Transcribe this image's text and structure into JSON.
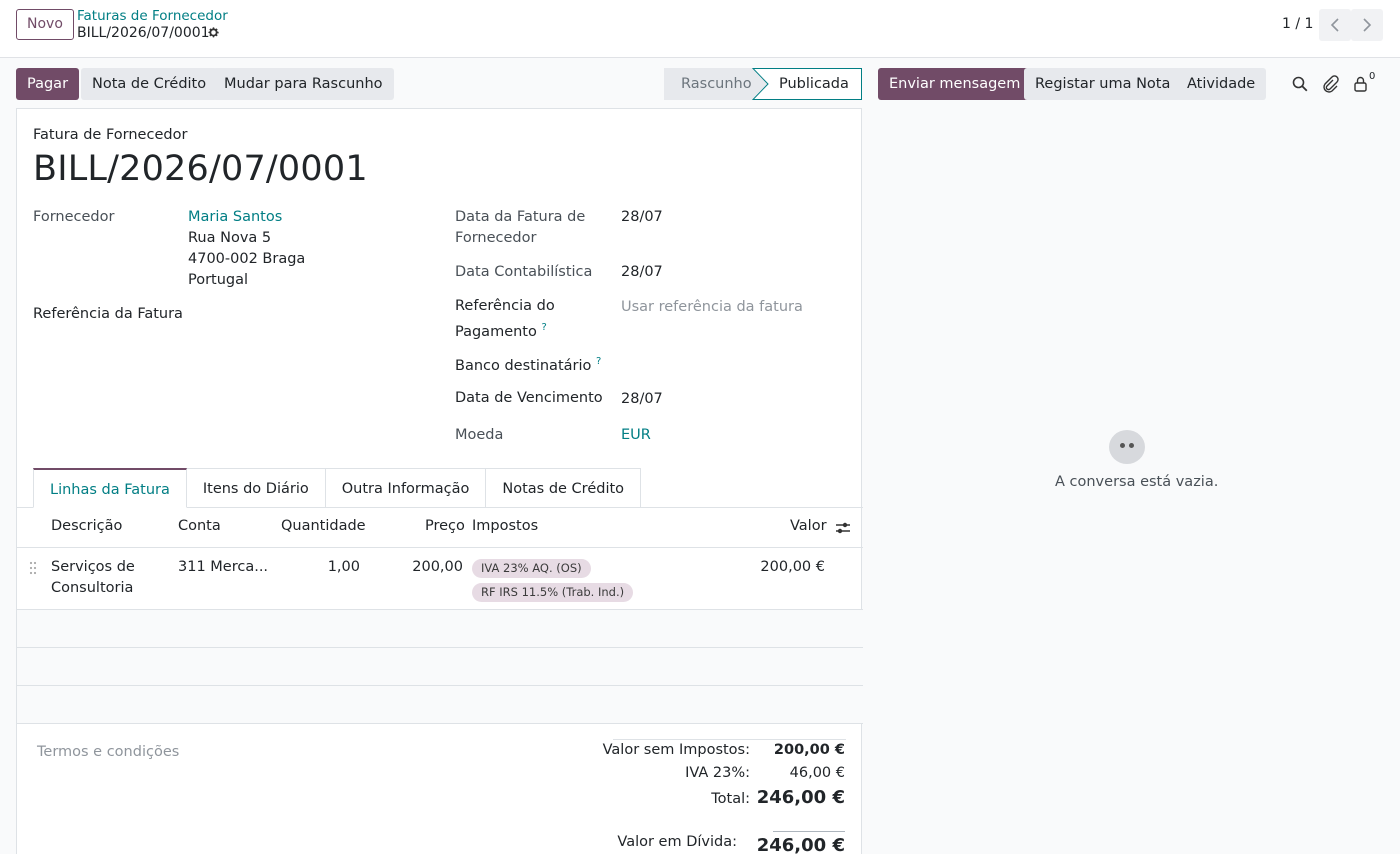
{
  "topbar": {
    "new_label": "Novo",
    "breadcrumb_parent": "Faturas de Fornecedor",
    "breadcrumb_current": "BILL/2026/07/0001",
    "pager": "1 / 1"
  },
  "actions": {
    "pay": "Pagar",
    "credit_note": "Nota de Crédito",
    "reset_draft": "Mudar para Rascunho"
  },
  "status": {
    "draft": "Rascunho",
    "posted": "Publicada"
  },
  "chatter": {
    "send_message": "Enviar mensagem",
    "log_note": "Registar uma Nota",
    "activity": "Atividade",
    "follower_count": "0",
    "empty_text": "A conversa está vazia."
  },
  "form": {
    "type": "Fatura de Fornecedor",
    "name": "BILL/2026/07/0001",
    "vendor_label": "Fornecedor",
    "vendor_name": "Maria Santos",
    "vendor_street": "Rua Nova 5",
    "vendor_city": "4700-002 Braga",
    "vendor_country": "Portugal",
    "bill_ref_label": "Referência da Fatura",
    "bill_date_label": "Data da Fatura de Fornecedor",
    "bill_date": "28/07",
    "accounting_date_label": "Data Contabilística",
    "accounting_date": "28/07",
    "payment_ref_label": "Referência do Pagamento",
    "payment_ref_placeholder": "Usar referência da fatura",
    "recipient_bank_label": "Banco destinatário",
    "due_date_label": "Data de Vencimento",
    "due_date": "28/07",
    "currency_label": "Moeda",
    "currency": "EUR"
  },
  "tabs": [
    "Linhas da Fatura",
    "Itens do Diário",
    "Outra Informação",
    "Notas de Crédito"
  ],
  "lines": {
    "headers": {
      "description": "Descrição",
      "account": "Conta",
      "quantity": "Quantidade",
      "price": "Preço",
      "taxes": "Impostos",
      "amount": "Valor"
    },
    "rows": [
      {
        "description": "Serviços de Consultoria",
        "account": "311 Merca...",
        "quantity": "1,00",
        "price": "200,00",
        "taxes": [
          "IVA 23% AQ. (OS)",
          "RF IRS 11.5% (Trab. Ind.)"
        ],
        "amount": "200,00 €"
      }
    ]
  },
  "totals": {
    "terms_placeholder": "Termos e condições",
    "untaxed_label": "Valor sem Impostos:",
    "untaxed": "200,00 €",
    "vat_label": "IVA 23%:",
    "vat": "46,00 €",
    "total_label": "Total:",
    "total": "246,00 €",
    "residual_label": "Valor em Dívida:",
    "residual": "246,00 €"
  },
  "colors": {
    "primary": "#714b67",
    "link": "#017e84"
  }
}
